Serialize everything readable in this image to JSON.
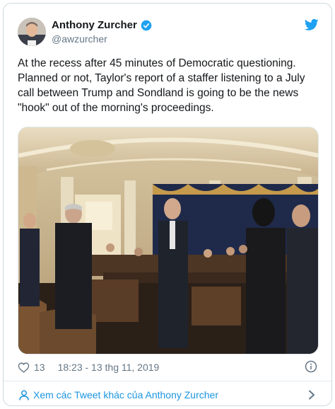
{
  "author": {
    "display_name": "Anthony Zurcher",
    "handle": "@awzurcher",
    "verified_icon": "verified-badge-icon"
  },
  "tweet": {
    "text": "At the recess after 45 minutes of Democratic questioning. Planned or not, Taylor's report of a staffer listening to a July call between Trump and Sondland is going to be the news \"hook\" out of the morning's proceedings.",
    "photo_icon": "hearing-room-photo"
  },
  "meta": {
    "like_count": "13",
    "timestamp": "18:23 - 13 thg 11, 2019"
  },
  "footer": {
    "more_tweets_label": "Xem các Tweet khác của Anthony Zurcher"
  },
  "colors": {
    "twitter_blue": "#1da1f2",
    "link_blue": "#1b95e0",
    "secondary_text": "#657786",
    "border": "#e1e8ed"
  }
}
